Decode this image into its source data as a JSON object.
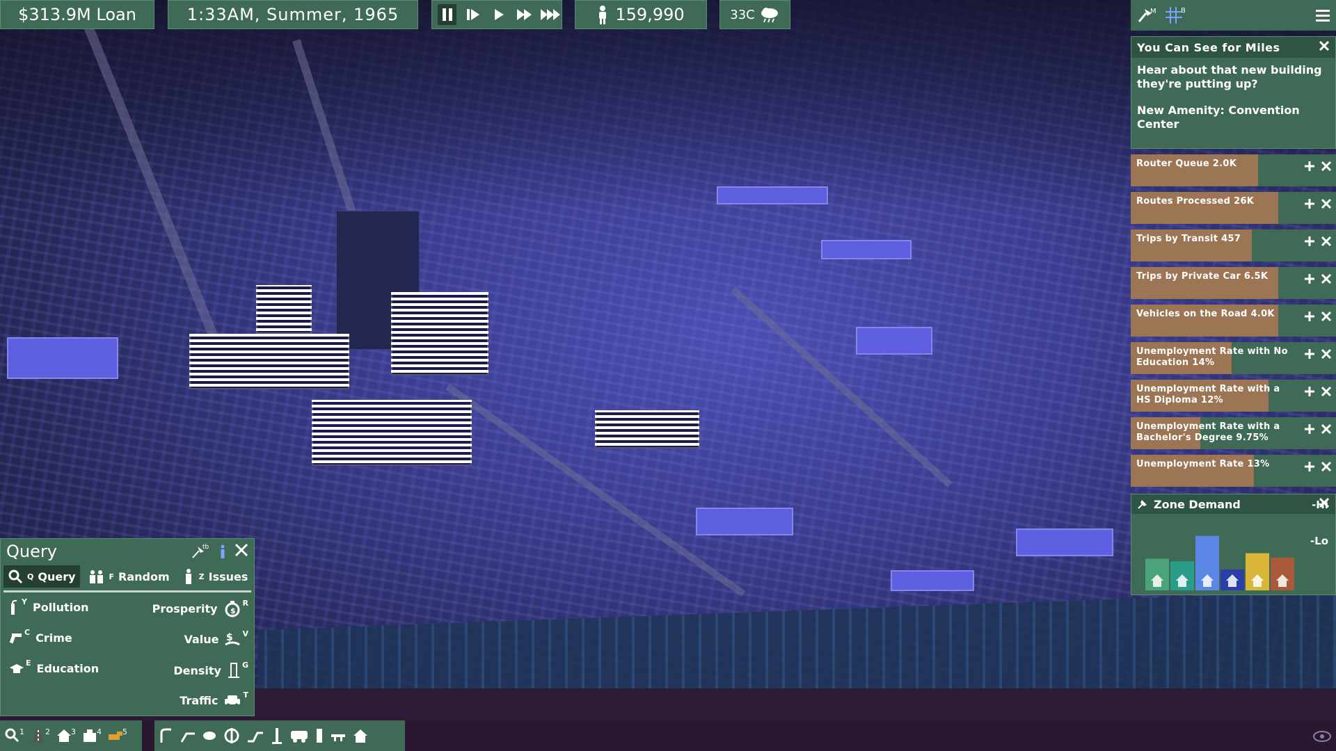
{
  "topbar": {
    "loan": "$313.9M Loan",
    "clock": "1:33AM,  Summer,  1965",
    "population": "159,990",
    "temperature": "33C"
  },
  "messages": {
    "title": "You Can See for Miles",
    "body1": "Hear about that new building they're putting up?",
    "body2": "New Amenity: Convention Center"
  },
  "stats": [
    {
      "label": "Router Queue 2.0K",
      "fill": 0.62
    },
    {
      "label": "Routes Processed 26K",
      "fill": 0.72
    },
    {
      "label": "Trips by Transit 457",
      "fill": 0.59
    },
    {
      "label": "Trips by Private Car 6.5K",
      "fill": 0.72
    },
    {
      "label": "Vehicles on the Road 4.0K",
      "fill": 0.72
    },
    {
      "label": "Unemployment Rate with No Education 14%",
      "fill": 0.49
    },
    {
      "label": "Unemployment Rate with a HS Diploma 12%",
      "fill": 0.67
    },
    {
      "label": "Unemployment Rate with a Bachelor's Degree 9.75%",
      "fill": 0.34
    },
    {
      "label": "Unemployment Rate 13%",
      "fill": 0.6
    }
  ],
  "zone": {
    "title": "Zone Demand",
    "hi": "-Hi",
    "lo": "-Lo",
    "bars": [
      {
        "name": "residential-low",
        "level": 0.2,
        "color": "#4aa37a"
      },
      {
        "name": "residential-high",
        "level": 0.15,
        "color": "#2a9c8a"
      },
      {
        "name": "commercial-low",
        "level": 0.62,
        "color": "#5b86e6"
      },
      {
        "name": "commercial-high",
        "level": 0.0,
        "color": "#2c3fa8"
      },
      {
        "name": "amenity",
        "level": 0.3,
        "color": "#d9b63a"
      },
      {
        "name": "industrial",
        "level": 0.22,
        "color": "#a85a3a"
      }
    ]
  },
  "query": {
    "title": "Query",
    "tabs": {
      "query": "Query",
      "query_key": "Q",
      "random": "Random",
      "random_key": "F",
      "issues": "Issues",
      "issues_key": "Z"
    },
    "items": {
      "pollution": "Pollution",
      "pollution_key": "Y",
      "crime": "Crime",
      "crime_key": "C",
      "education": "Education",
      "education_key": "E",
      "prosperity": "Prosperity",
      "prosperity_key": "R",
      "value": "Value",
      "value_key": "V",
      "density": "Density",
      "density_key": "G",
      "traffic": "Traffic",
      "traffic_key": "T"
    },
    "pin_key": "tb"
  },
  "toolbar": {
    "left": [
      {
        "icon": "query-tool-icon",
        "num": "1"
      },
      {
        "icon": "road-tool-icon",
        "num": "2"
      },
      {
        "icon": "zone-tool-icon",
        "num": "3"
      },
      {
        "icon": "building-tool-icon",
        "num": "4"
      },
      {
        "icon": "bulldoze-tool-icon",
        "num": "5"
      }
    ]
  },
  "colors": {
    "panel": "#3f6a55",
    "panel_dark": "#2f5443",
    "stat_fill": "#9c7654",
    "night_sky": "#1b1d3d"
  }
}
